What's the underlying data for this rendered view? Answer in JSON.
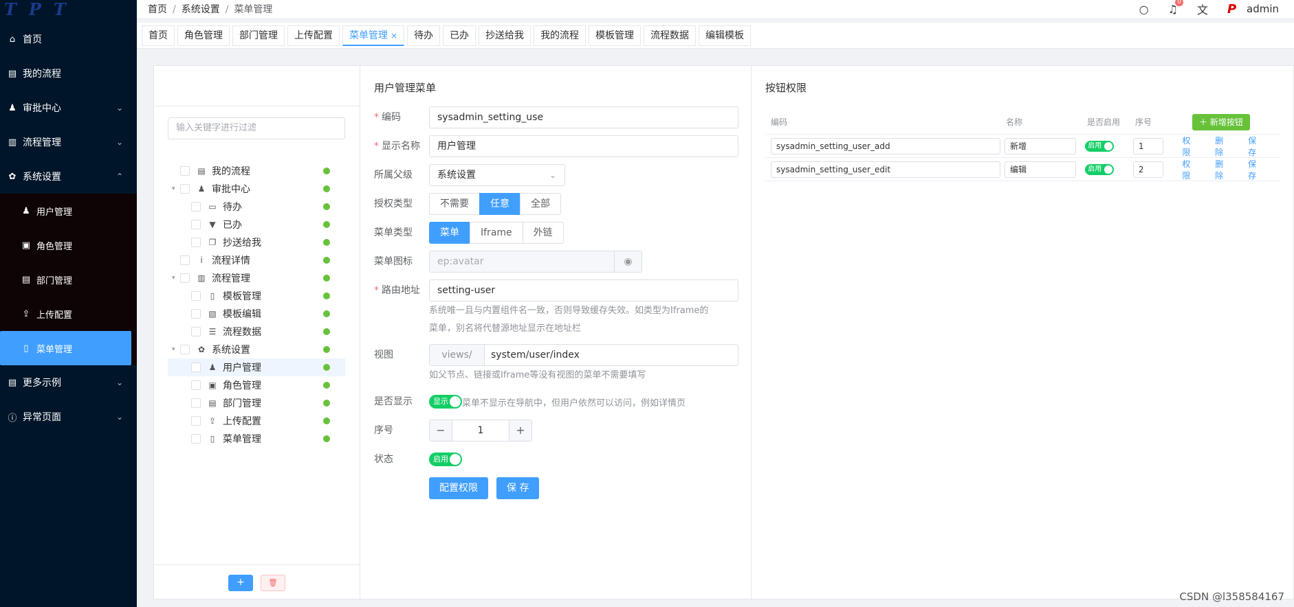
{
  "logo_text": "TPT",
  "sidebar": {
    "items": [
      {
        "label": "首页",
        "icon": "home-icon"
      },
      {
        "label": "我的流程",
        "icon": "book-icon"
      },
      {
        "label": "审批中心",
        "icon": "user-icon",
        "expandable": true
      },
      {
        "label": "流程管理",
        "icon": "list-icon",
        "expandable": true
      },
      {
        "label": "系统设置",
        "icon": "gear-icon",
        "expanded": true
      },
      {
        "label": "更多示例",
        "icon": "document-icon",
        "expandable": true
      },
      {
        "label": "异常页面",
        "icon": "info-icon",
        "expandable": true
      }
    ],
    "sub_items": [
      {
        "label": "用户管理"
      },
      {
        "label": "角色管理"
      },
      {
        "label": "部门管理"
      },
      {
        "label": "上传配置"
      },
      {
        "label": "菜单管理",
        "active": true
      }
    ]
  },
  "header": {
    "breadcrumb": [
      "首页",
      "系统设置",
      "菜单管理"
    ],
    "notification_count": "0",
    "user": "admin"
  },
  "tabs": [
    "首页",
    "角色管理",
    "部门管理",
    "上传配置",
    "菜单管理",
    "待办",
    "已办",
    "抄送给我",
    "我的流程",
    "模板管理",
    "流程数据",
    "编辑模板"
  ],
  "active_tab": "菜单管理",
  "tree": {
    "search_placeholder": "输入关键字进行过滤",
    "nodes": [
      {
        "label": "我的流程",
        "level": 0,
        "icon": "book-icon"
      },
      {
        "label": "审批中心",
        "level": 0,
        "icon": "user-icon",
        "expanded": true
      },
      {
        "label": "待办",
        "level": 1,
        "icon": "inbox-icon"
      },
      {
        "label": "已办",
        "level": 1,
        "icon": "stamp-icon"
      },
      {
        "label": "抄送给我",
        "level": 1,
        "icon": "copy-icon"
      },
      {
        "label": "流程详情",
        "level": 0,
        "icon": "info-icon"
      },
      {
        "label": "流程管理",
        "level": 0,
        "icon": "list-icon",
        "expanded": true
      },
      {
        "label": "模板管理",
        "level": 1,
        "icon": "file-icon"
      },
      {
        "label": "模板编辑",
        "level": 1,
        "icon": "edit-file-icon"
      },
      {
        "label": "流程数据",
        "level": 1,
        "icon": "database-icon"
      },
      {
        "label": "系统设置",
        "level": 0,
        "icon": "gear-icon",
        "expanded": true
      },
      {
        "label": "用户管理",
        "level": 1,
        "icon": "user-icon",
        "selected": true
      },
      {
        "label": "角色管理",
        "level": 1,
        "icon": "id-card-icon"
      },
      {
        "label": "部门管理",
        "level": 1,
        "icon": "book-icon"
      },
      {
        "label": "上传配置",
        "level": 1,
        "icon": "upload-icon"
      },
      {
        "label": "菜单管理",
        "level": 1,
        "icon": "document-icon"
      }
    ],
    "add_label": "+",
    "delete_label": "🗑"
  },
  "form": {
    "title": "用户管理菜单",
    "code_label": "编码",
    "code_value": "sysadmin_setting_use",
    "name_label": "显示名称",
    "name_value": "用户管理",
    "parent_label": "所属父级",
    "parent_value": "系统设置",
    "auth_label": "授权类型",
    "auth_options": [
      "不需要",
      "任意",
      "全部"
    ],
    "auth_selected": "任意",
    "type_label": "菜单类型",
    "type_options": [
      "菜单",
      "Iframe",
      "外链"
    ],
    "type_selected": "菜单",
    "icon_label": "菜单图标",
    "icon_value": "ep:avatar",
    "route_label": "路由地址",
    "route_value": "setting-user",
    "route_help_1": "系统唯一且与内置组件名一致，否则导致缓存失效。如类型为Iframe的",
    "route_help_2": "菜单，别名将代替源地址显示在地址栏",
    "view_label": "视图",
    "view_prefix": "views/",
    "view_value": "system/user/index",
    "view_help": "如父节点、链接或Iframe等没有视图的菜单不需要填写",
    "show_label": "是否显示",
    "show_switch": "显示",
    "show_help": "菜单不显示在导航中，但用户依然可以访问，例如详情页",
    "order_label": "序号",
    "order_value": "1",
    "status_label": "状态",
    "status_switch": "启用",
    "config_btn": "配置权限",
    "save_btn": "保 存"
  },
  "permissions": {
    "title": "按钮权限",
    "headers": {
      "code": "编码",
      "name": "名称",
      "enabled": "是否启用",
      "order": "序号"
    },
    "add_btn": "新增按钮",
    "rows": [
      {
        "code": "sysadmin_setting_user_add",
        "name": "新增",
        "enabled": "启用",
        "order": "1"
      },
      {
        "code": "sysadmin_setting_user_edit",
        "name": "编辑",
        "enabled": "启用",
        "order": "2"
      }
    ],
    "actions": [
      "权限",
      "删除",
      "保存"
    ]
  },
  "watermark": "CSDN @l358584167"
}
